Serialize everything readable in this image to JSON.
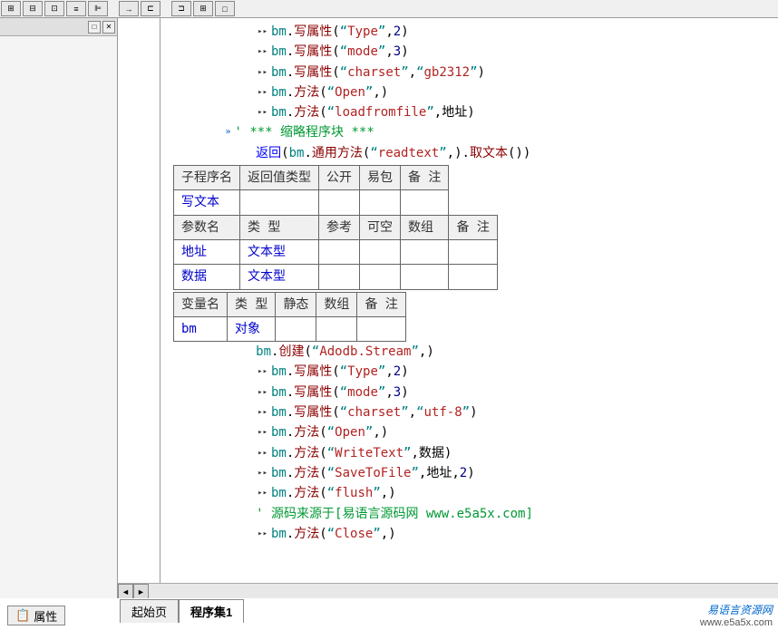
{
  "toolbar": {
    "buttons": [
      "⊞",
      "⊟",
      "⊡",
      "≡",
      "⊫",
      "→",
      "⊏",
      "⊐",
      "⊞",
      "□"
    ]
  },
  "panel": {
    "mini": [
      "□",
      "✕"
    ]
  },
  "code": {
    "lines": [
      {
        "t": "m",
        "obj": "bm",
        "m": "写属性",
        "args": [
          "\"Type\"",
          "2"
        ]
      },
      {
        "t": "m",
        "obj": "bm",
        "m": "写属性",
        "args": [
          "\"mode\"",
          "3"
        ]
      },
      {
        "t": "m",
        "obj": "bm",
        "m": "写属性",
        "args": [
          "\"charset\"",
          "\"gb2312\""
        ]
      },
      {
        "t": "m",
        "obj": "bm",
        "m": "方法",
        "args": [
          "\"Open\"",
          ""
        ]
      },
      {
        "t": "m",
        "obj": "bm",
        "m": "方法",
        "args": [
          "\"loadfromfile\"",
          "地址"
        ]
      },
      {
        "t": "cmt",
        "txt": "' *** 缩略程序块 ***"
      },
      {
        "t": "ret",
        "obj": "bm",
        "m": "通用方法",
        "args": [
          "\"readtext\"",
          ""
        ],
        "suffix": "取文本"
      },
      {
        "t": "tbl1"
      },
      {
        "t": "tbl2"
      },
      {
        "t": "c",
        "obj": "bm",
        "m": "创建",
        "args": [
          "\"Adodb.Stream\"",
          ""
        ]
      },
      {
        "t": "m",
        "obj": "bm",
        "m": "写属性",
        "args": [
          "\"Type\"",
          "2"
        ]
      },
      {
        "t": "m",
        "obj": "bm",
        "m": "写属性",
        "args": [
          "\"mode\"",
          "3"
        ]
      },
      {
        "t": "m",
        "obj": "bm",
        "m": "写属性",
        "args": [
          "\"charset\"",
          "\"utf-8\""
        ]
      },
      {
        "t": "m",
        "obj": "bm",
        "m": "方法",
        "args": [
          "\"Open\"",
          ""
        ]
      },
      {
        "t": "m",
        "obj": "bm",
        "m": "方法",
        "args": [
          "\"WriteText\"",
          "数据"
        ],
        "cursor": true
      },
      {
        "t": "m",
        "obj": "bm",
        "m": "方法",
        "args": [
          "\"SaveToFile\"",
          "地址",
          "2"
        ]
      },
      {
        "t": "m",
        "obj": "bm",
        "m": "方法",
        "args": [
          "\"flush\"",
          ""
        ]
      },
      {
        "t": "cmt2",
        "txt": "' 源码来源于[易语言源码网 www.e5a5x.com]"
      },
      {
        "t": "m",
        "obj": "bm",
        "m": "方法",
        "args": [
          "\"Close \"",
          ""
        ]
      }
    ]
  },
  "table1": {
    "h1": [
      "子程序名",
      "返回值类型",
      "公开",
      "易包",
      "备 注"
    ],
    "r1": [
      "写文本",
      "",
      "",
      "",
      ""
    ],
    "h2": [
      "参数名",
      "类 型",
      "参考",
      "可空",
      "数组",
      "备 注"
    ],
    "r2": [
      "地址",
      "文本型",
      "",
      "",
      "",
      ""
    ],
    "r3": [
      "数据",
      "文本型",
      "",
      "",
      "",
      ""
    ]
  },
  "table2": {
    "h": [
      "变量名",
      "类 型",
      "静态",
      "数组",
      "备 注"
    ],
    "r": [
      "bm",
      "对象",
      "",
      "",
      ""
    ]
  },
  "bottom": {
    "prop": "属性",
    "tab1": "起始页",
    "tab2": "程序集1"
  },
  "watermark": {
    "line1": "易语言资源网",
    "line2": "www.e5a5x.com"
  },
  "markers": {
    "down": "↓",
    "plus": "+"
  }
}
